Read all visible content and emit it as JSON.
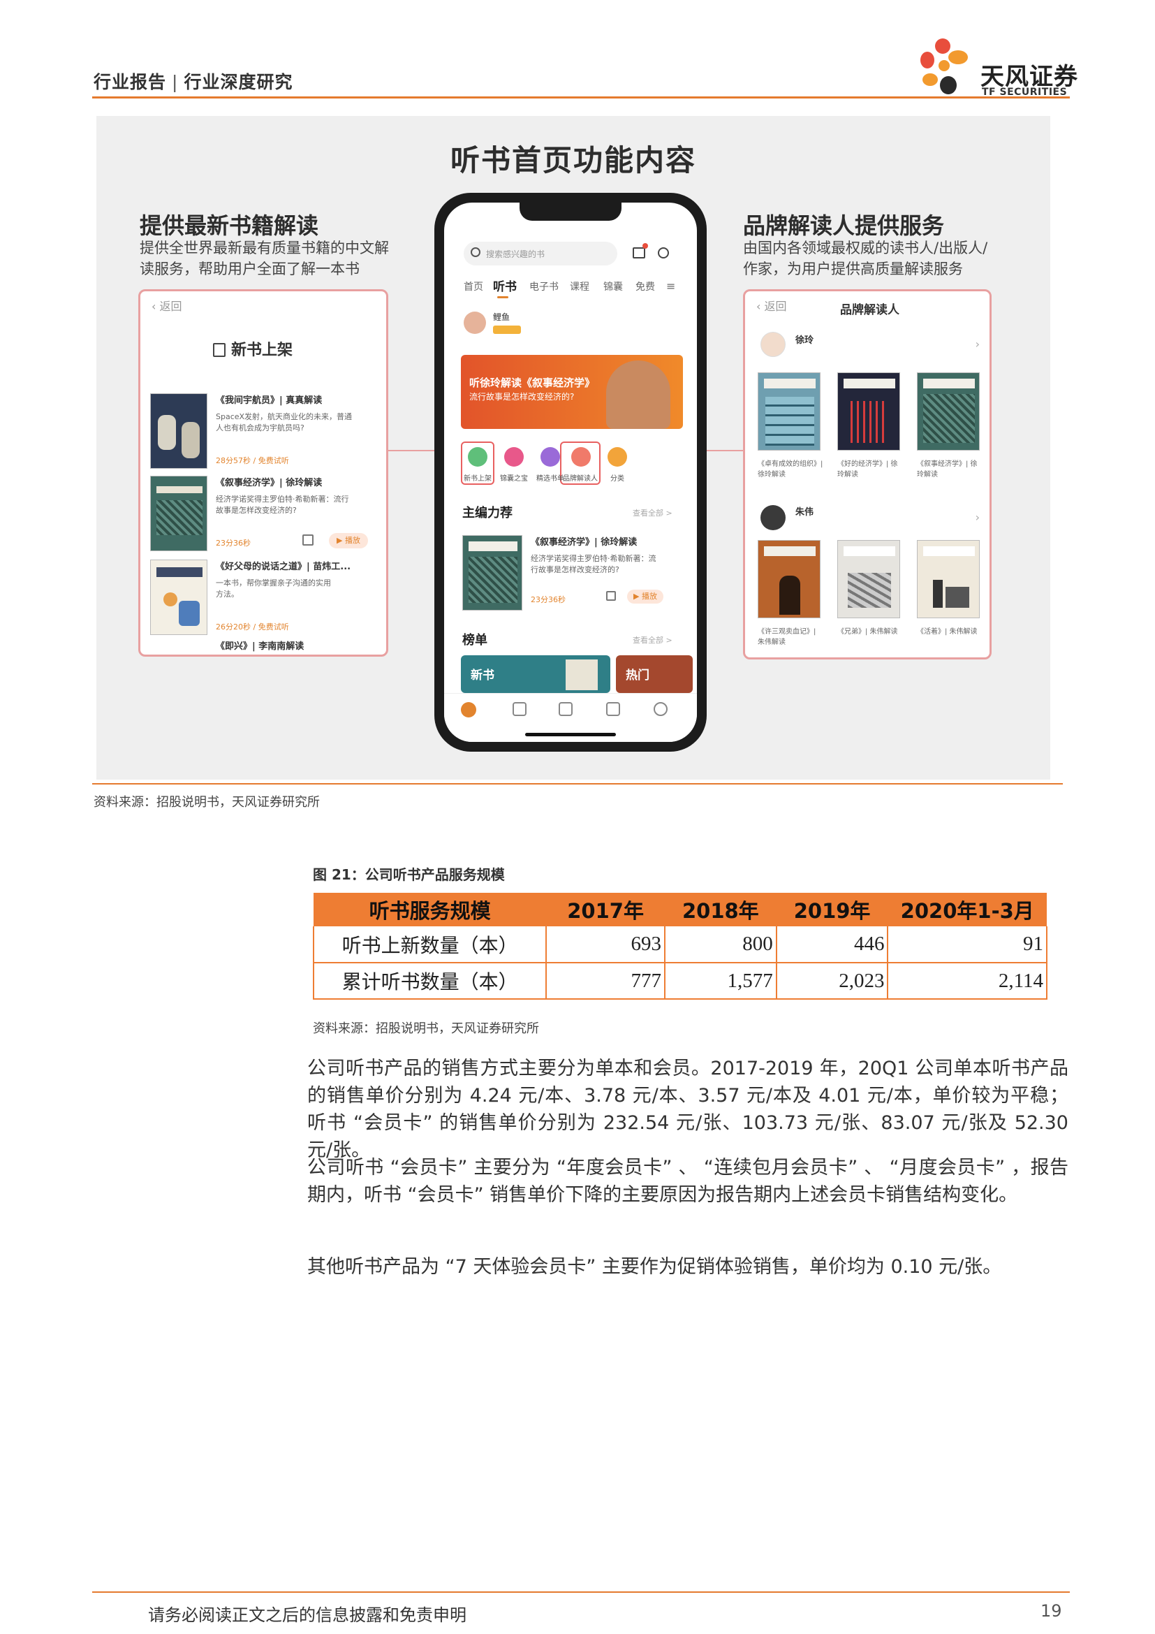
{
  "header": {
    "title_left": "行业报告",
    "title_right": "行业深度研究",
    "logo_name": "天风证券",
    "logo_sub": "TF SECURITIES"
  },
  "figure": {
    "title": "听书首页功能内容",
    "left": {
      "heading": "提供最新书籍解读",
      "desc_line1": "提供全世界最新最有质量书籍的中文解",
      "desc_line2": "读服务，帮助用户全面了解一本书",
      "panel_head": "新书上架",
      "items": [
        {
          "title": "《我间宇航员》| 真真解读",
          "desc1": "SpaceX发射，航天商业化的未来，普通",
          "desc2": "人也有机会成为宇航员吗?",
          "time": "28分57秒 / 免费试听"
        },
        {
          "title": "《叙事经济学》| 徐玲解读",
          "desc1": "经济学诺奖得主罗伯特·希勒新著：流行",
          "desc2": "故事是怎样改变经济的?",
          "time": "23分36秒"
        },
        {
          "title": "《好父母的说话之道》| 苗炜工...",
          "desc1": "一本书，帮你掌握亲子沟通的实用",
          "desc2": "方法。",
          "time": "26分20秒 / 免费试听"
        },
        {
          "title": "《即兴》| 李南南解读",
          "desc1": "",
          "desc2": "",
          "time": ""
        }
      ]
    },
    "right": {
      "heading": "品牌解读人提供服务",
      "desc_line1": "由国内各领域最权威的读书人/出版人/",
      "desc_line2": "作家，为用户提供高质量解读服务",
      "panel_head": "品牌解读人",
      "people": [
        {
          "name": "徐玲",
          "books": [
            "《卓有成效的组织》| 徐玲解读",
            "《好的经济学》| 徐玲解读",
            "《叙事经济学》| 徐玲解读"
          ]
        },
        {
          "name": "朱伟",
          "books": [
            "《许三观卖血记》| 朱伟解读",
            "《兄弟》| 朱伟解读",
            "《活着》| 朱伟解读"
          ]
        }
      ]
    },
    "phone": {
      "search_placeholder": "搜索感兴趣的书",
      "tabs": [
        "首页",
        "听书",
        "电子书",
        "课程",
        "锦囊",
        "免费"
      ],
      "user_name": "鲤鱼",
      "banner_line1": "听徐玲解读《叙事经济学》",
      "banner_line2": "流行故事是怎样改变经济的?",
      "icons": [
        "新书上架",
        "锦囊之宝",
        "精选书单",
        "品牌解读人",
        "分类"
      ],
      "section1": "主编力荐",
      "rec_title": "《叙事经济学》| 徐玲解读",
      "rec_desc1": "经济学诺奖得主罗伯特·希勒新著：流",
      "rec_desc2": "行故事是怎样改变经济的?",
      "rec_time": "23分36秒",
      "section2": "榜单",
      "chart_cards": [
        "新书",
        "热门"
      ],
      "more": "查看全部 >",
      "play": "播放"
    }
  },
  "source1": "资料来源：招股说明书，天风证券研究所",
  "table": {
    "title": "图 21：公司听书产品服务规模",
    "headers": [
      "听书服务规模",
      "2017年",
      "2018年",
      "2019年",
      "2020年1-3月"
    ],
    "rows": [
      {
        "label": "听书上新数量（本）",
        "values": [
          "693",
          "800",
          "446",
          "91"
        ]
      },
      {
        "label": "累计听书数量（本）",
        "values": [
          "777",
          "1,577",
          "2,023",
          "2,114"
        ]
      }
    ]
  },
  "source2": "资料来源：招股说明书，天风证券研究所",
  "paragraphs": [
    "公司听书产品的销售方式主要分为单本和会员。2017-2019 年，20Q1 公司单本听书产品的销售单价分别为 4.24 元/本、3.78 元/本、3.57 元/本及 4.01 元/本，单价较为平稳； 听书 “会员卡” 的销售单价分别为 232.54 元/张、103.73 元/张、83.07 元/张及 52.30 元/张。",
    "公司听书 “会员卡” 主要分为 “年度会员卡” 、 “连续包月会员卡” 、 “月度会员卡” ，报告期内，听书 “会员卡”  销售单价下降的主要原因为报告期内上述会员卡销售结构变化。",
    "其他听书产品为 “7 天体验会员卡” 主要作为促销体验销售，单价均为 0.10 元/张。"
  ],
  "footer": {
    "disclaimer": "请务必阅读正文之后的信息披露和免责申明",
    "page": "19"
  },
  "colors": {
    "accent": "#ee7d33",
    "rule": "#e57a2e",
    "panel_border": "#e8a0a0"
  }
}
